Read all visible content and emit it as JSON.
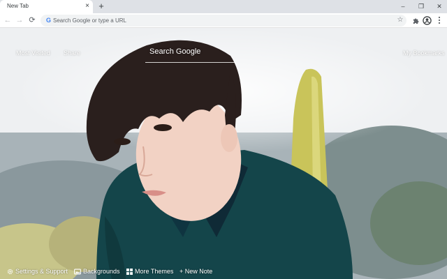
{
  "browser": {
    "tab": {
      "title": "New Tab",
      "close_glyph": "×"
    },
    "new_tab_glyph": "+",
    "window_controls": [
      "–",
      "❐",
      "✕"
    ],
    "nav": {
      "back": "←",
      "forward": "→",
      "reload": "⟳"
    },
    "omnibox": {
      "google_glyph": "G",
      "placeholder": "Search Google or type a URL",
      "value": ""
    },
    "star_glyph": "☆",
    "toolbar_icons": [
      "extensions-icon",
      "profile-icon",
      "kebab-menu-icon"
    ]
  },
  "newtab": {
    "top_links": {
      "most_visited": "Most Visited",
      "share": "Share",
      "my_bookmarks": "My Bookmarks"
    },
    "search": {
      "label": "Search Google"
    },
    "bottom_bar": {
      "settings": "Settings & Support",
      "backgrounds": "Backgrounds",
      "more_themes": "More Themes",
      "new_note": "+ New Note"
    }
  },
  "colors": {
    "tabstrip_bg": "#dee1e6",
    "toolbar_bg": "#ffffff",
    "omnibox_bg": "#f1f3f4",
    "jacket": "#14454a",
    "hair": "#2a1f1d",
    "skin": "#f2d2c4"
  }
}
